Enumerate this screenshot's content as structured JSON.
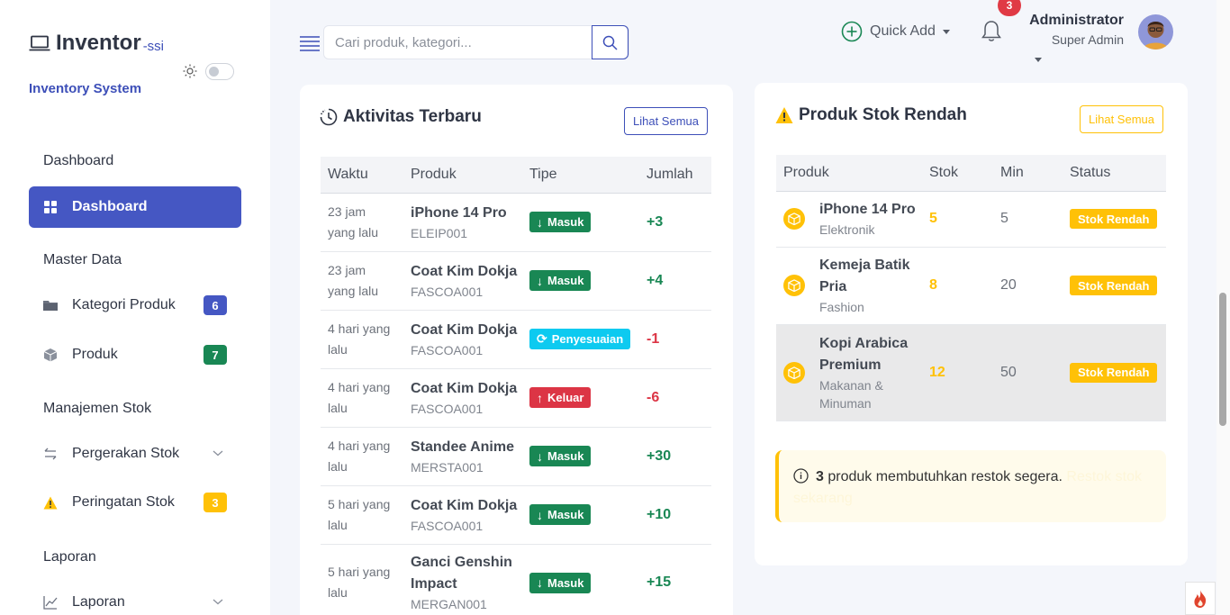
{
  "brand": {
    "name": "Inventor",
    "suffix": "-ssi",
    "subtitle": "Inventory System"
  },
  "sidebar": {
    "sections": [
      {
        "title": "Dashboard"
      },
      {
        "title": "Master Data"
      },
      {
        "title": "Manajemen Stok"
      },
      {
        "title": "Laporan"
      }
    ],
    "items": [
      {
        "label": "Dashboard",
        "icon": "grid-icon"
      },
      {
        "label": "Kategori Produk",
        "icon": "folder-icon",
        "badge": "6",
        "badge_color": "#4557c3"
      },
      {
        "label": "Produk",
        "icon": "box-icon",
        "badge": "7",
        "badge_color": "#198754"
      },
      {
        "label": "Pergerakan Stok",
        "icon": "arrows-exchange-icon"
      },
      {
        "label": "Peringatan Stok",
        "icon": "warning-icon",
        "badge": "3",
        "badge_color": "#ffc107"
      },
      {
        "label": "Laporan",
        "icon": "chart-line-icon"
      }
    ]
  },
  "topbar": {
    "search_placeholder": "Cari produk, kategori...",
    "quick_add": "Quick Add",
    "notifications": "3",
    "user": {
      "name": "Administrator",
      "role": "Super Admin"
    }
  },
  "activity": {
    "title": "Aktivitas Terbaru",
    "view_all": "Lihat Semua",
    "columns": [
      "Waktu",
      "Produk",
      "Tipe",
      "Jumlah"
    ],
    "rows": [
      {
        "time1": "23 jam",
        "time2": "yang lalu",
        "product": "iPhone 14 Pro",
        "code": "ELEIP001",
        "type": "Masuk",
        "qty": "+3"
      },
      {
        "time1": "23 jam",
        "time2": "yang lalu",
        "product": "Coat Kim Dokja",
        "code": "FASCOA001",
        "type": "Masuk",
        "qty": "+4"
      },
      {
        "time1": "4 hari yang",
        "time2": "lalu",
        "product": "Coat Kim Dokja",
        "code": "FASCOA001",
        "type": "Penyesuaian",
        "qty": "-1"
      },
      {
        "time1": "4 hari yang",
        "time2": "lalu",
        "product": "Coat Kim Dokja",
        "code": "FASCOA001",
        "type": "Keluar",
        "qty": "-6"
      },
      {
        "time1": "4 hari yang",
        "time2": "lalu",
        "product": "Standee Anime",
        "code": "MERSTA001",
        "type": "Masuk",
        "qty": "+30"
      },
      {
        "time1": "5 hari yang",
        "time2": "lalu",
        "product": "Coat Kim Dokja",
        "code": "FASCOA001",
        "type": "Masuk",
        "qty": "+10"
      },
      {
        "time1": "5 hari yang",
        "time2": "lalu",
        "product": "Ganci Genshin Impact",
        "code": "MERGAN001",
        "type": "Masuk",
        "qty": "+15"
      }
    ]
  },
  "low_stock": {
    "title": "Produk Stok Rendah",
    "view_all": "Lihat Semua",
    "columns": [
      "Produk",
      "Stok",
      "Min",
      "Status"
    ],
    "rows": [
      {
        "name": "iPhone 14 Pro",
        "category": "Elektronik",
        "stock": "5",
        "min": "5",
        "status": "Stok Rendah"
      },
      {
        "name": "Kemeja Batik Pria",
        "category": "Fashion",
        "stock": "8",
        "min": "20",
        "status": "Stok Rendah"
      },
      {
        "name": "Kopi Arabica Premium",
        "category": "Makanan & Minuman",
        "stock": "12",
        "min": "50",
        "status": "Stok Rendah"
      }
    ],
    "alert_count": "3",
    "alert_text": " produk membutuhkan restok segera.",
    "alert_link": "Restok stok sekarang"
  },
  "colors": {
    "primary": "#4557c3",
    "success": "#198754",
    "danger": "#dc3545",
    "info": "#0dcaf0",
    "warning": "#ffc107"
  }
}
